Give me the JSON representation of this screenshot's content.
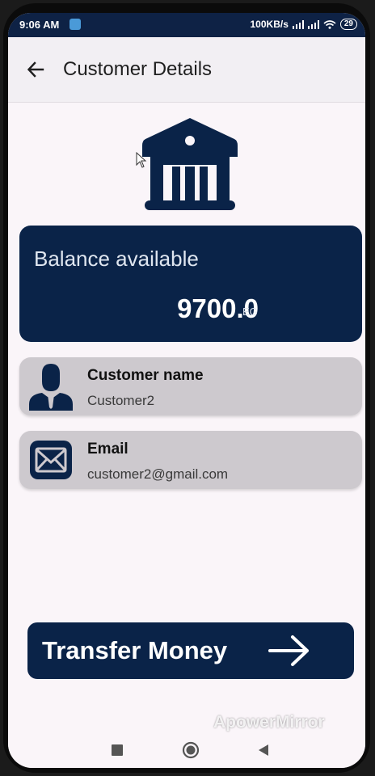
{
  "status_bar": {
    "time": "9:06 AM",
    "network_speed": "100KB/s",
    "battery": "29"
  },
  "app_bar": {
    "title": "Customer Details",
    "back_icon": "arrow-left-icon"
  },
  "header_icon": "bank-icon",
  "balance": {
    "label": "Balance available",
    "amount": "9700.0",
    "currency": "EG"
  },
  "customer": {
    "name_title": "Customer name",
    "name_value": "Customer2",
    "name_icon": "person-icon",
    "email_title": "Email",
    "email_value": "customer2@gmail.com",
    "email_icon": "envelope-icon"
  },
  "transfer_button": {
    "label": "Transfer Money",
    "icon": "arrow-right-icon"
  },
  "watermark": "ApowerMirror",
  "colors": {
    "primary": "#0a2348",
    "card_gray": "#cdc9ce",
    "background": "#faf5f9"
  }
}
